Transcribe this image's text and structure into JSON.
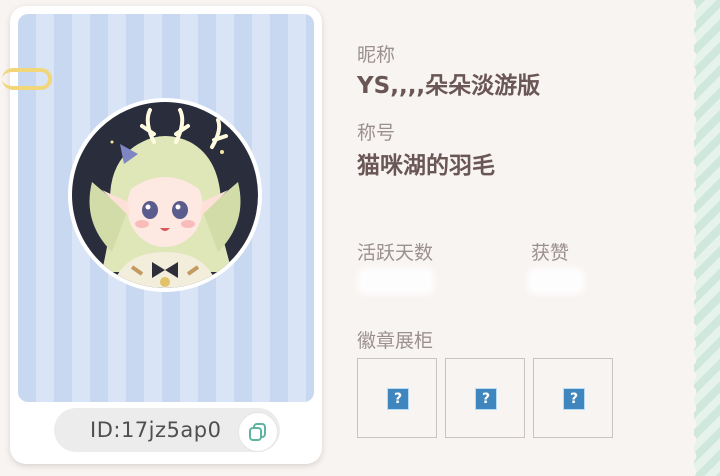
{
  "profile": {
    "id_text": "ID:17jz5ap0"
  },
  "info": {
    "nickname_label": "昵称",
    "nickname_value": "YS,,,,朵朵淡游版",
    "title_label": "称号",
    "title_value": "猫咪湖的羽毛",
    "active_days_label": "活跃天数",
    "likes_label": "获赞",
    "badges_label": "徽章展柜"
  },
  "badges": [
    {
      "glyph": "?"
    },
    {
      "glyph": "?"
    },
    {
      "glyph": "?"
    }
  ],
  "colors": {
    "accent_mint": "#cfe7dd",
    "card_stripe": "#c9d8f1",
    "badge_blue": "#3f86bf"
  },
  "icons": [
    "copy-icon",
    "paperclip-icon",
    "question-mark-icon"
  ]
}
